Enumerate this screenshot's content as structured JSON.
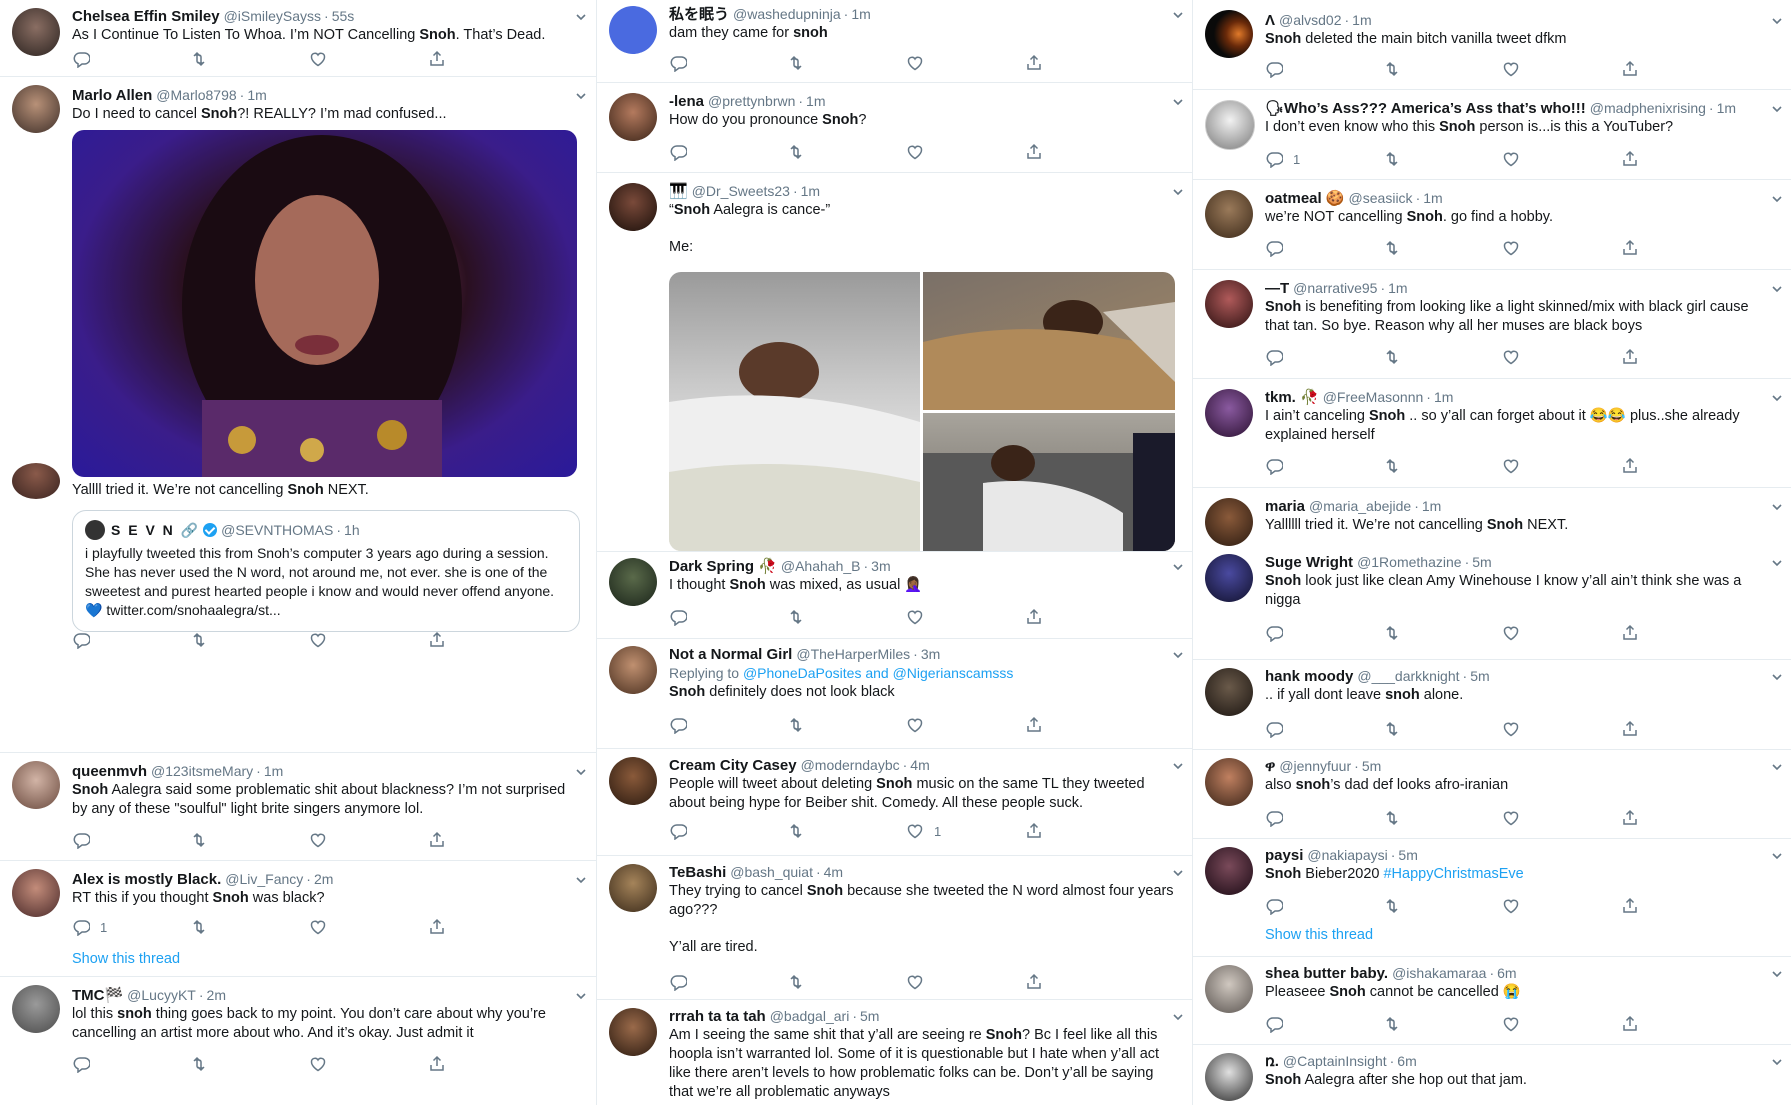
{
  "colors": {
    "accent": "#1da1f2",
    "muted": "#657786",
    "text": "#14171a",
    "divider": "#e6ecf0"
  },
  "icons": {
    "reply": "reply-icon",
    "retweet": "retweet-icon",
    "like": "heart-icon",
    "share": "share-icon",
    "caret": "chevron-down-icon"
  },
  "col1": {
    "t1": {
      "name": "Chelsea Effin Smiley",
      "handle": "@iSmileySayss",
      "time": "55s",
      "text_pre": "As I Continue To Listen To Whoa. I’m NOT Cancelling ",
      "text_bold": "Snoh",
      "text_post": ". That’s Dead."
    },
    "t2": {
      "name": "Marlo Allen",
      "handle": "@Marlo8798",
      "time": "1m",
      "text_pre": "Do I need to cancel ",
      "text_bold": "Snoh",
      "text_post": "?! REALLY? I’m mad confused..."
    },
    "t3": {
      "text_pre": "Yallll tried it. We’re not cancelling ",
      "text_bold": "Snoh",
      "text_post": " NEXT.",
      "quote": {
        "name": "S E V N 🔗",
        "handle": "@SEVNTHOMAS",
        "time": "1h",
        "text": "i playfully tweeted this from Snoh’s computer 3 years ago during a session. She has never used the N word, not around me, not ever. she is one of the sweetest and purest hearted people i know and would never offend anyone. 💙 twitter.com/snohaalegra/st..."
      }
    },
    "t4": {
      "name": "queenmvh",
      "handle": "@123itsmeMary",
      "time": "1m",
      "text_bold": "Snoh",
      "text_post": " Aalegra said some problematic shit about blackness? I’m not surprised by any of these \"soulful\" light brite singers anymore lol."
    },
    "t5": {
      "name": "Alex is mostly Black.",
      "handle": "@Liv_Fancy",
      "time": "2m",
      "text_pre": "RT this if you thought ",
      "text_bold": "Snoh",
      "text_post": " was black?",
      "reply_count": "1",
      "show_thread": "Show this thread"
    },
    "t6": {
      "name": "TMC🏁",
      "handle": "@LucyyKT",
      "time": "2m",
      "text_pre": "lol this ",
      "text_bold": "snoh",
      "text_post": " thing goes back to my point. You don’t care about why you’re cancelling an artist more about who. And it’s okay. Just admit it"
    }
  },
  "col2": {
    "t1": {
      "name": "私を眠う",
      "handle": "@washedupninja",
      "time": "1m",
      "text_pre": "dam they came for ",
      "text_bold": "snoh",
      "text_post": ""
    },
    "t2": {
      "name": "-lena",
      "handle": "@prettynbrwn",
      "time": "1m",
      "text_pre": "How do you pronounce ",
      "text_bold": "Snoh",
      "text_post": "?"
    },
    "t3": {
      "name": "🎹",
      "handle": "@Dr_Sweets23",
      "time": "1m",
      "text_pre": "“",
      "text_bold": "Snoh",
      "text_post": " Aalegra is cance-”",
      "line2": "Me:"
    },
    "t4": {
      "name": "Dark Spring 🥀",
      "handle": "@Ahahah_B",
      "time": "3m",
      "text_pre": "I thought ",
      "text_bold": "Snoh",
      "text_post": " was mixed, as usual 🤦🏾‍♀️"
    },
    "t5": {
      "name": "Not a Normal Girl",
      "handle": "@TheHarperMiles",
      "time": "3m",
      "reply_label": "Replying to ",
      "reply_targets": "@PhoneDaPosites and @Nigerianscamsss",
      "text_bold": "Snoh",
      "text_post": " definitely does not look black"
    },
    "t6": {
      "name": "Cream City Casey",
      "handle": "@moderndaybc",
      "time": "4m",
      "text_pre": "People will tweet about deleting ",
      "text_bold": "Snoh",
      "text_post": " music on the same TL they tweeted about being hype for Beiber shit. Comedy. All these people suck.",
      "like_count": "1"
    },
    "t7": {
      "name": "TeBashi",
      "handle": "@bash_quiat",
      "time": "4m",
      "text_pre": "They trying to cancel ",
      "text_bold": "Snoh",
      "text_post": " because she tweeted the N word almost four years ago???",
      "line2": "Y’all are tired."
    },
    "t8": {
      "name": "rrrah ta ta tah",
      "handle": "@badgal_ari",
      "time": "5m",
      "text_pre": "Am I seeing the same shit that y’all are seeing re ",
      "text_bold": "Snoh",
      "text_post": "? Bc I feel like all this hoopla isn’t warranted lol. Some of it is questionable but I hate when y’all act like there aren’t levels to how problematic folks can be. Don’t y’all be saying that we’re all problematic anyways"
    }
  },
  "col3": {
    "t1": {
      "name": "Λ",
      "handle": "@alvsd02",
      "time": "1m",
      "text_bold": "Snoh",
      "text_post": " deleted the main bitch vanilla tweet dfkm"
    },
    "t2": {
      "name": "🗣Who’s Ass??? America’s Ass that’s who!!!",
      "handle": "@madphenixrising",
      "time": "1m",
      "text_pre": "I don’t even know who this ",
      "text_bold": "Snoh",
      "text_post": " person is...is this a YouTuber?",
      "reply_count": "1"
    },
    "t3": {
      "name": "oatmeal 🍪",
      "handle": "@seasiick",
      "time": "1m",
      "text_pre": "we’re NOT cancelling ",
      "text_bold": "Snoh",
      "text_post": ". go find a hobby."
    },
    "t4": {
      "name": "—T",
      "handle": "@narrative95",
      "time": "1m",
      "text_bold": "Snoh",
      "text_post": " is benefiting from looking like a light skinned/mix with black girl cause that tan. So bye. Reason why all her muses are black boys"
    },
    "t5": {
      "name": "tkm. 🥀",
      "handle": "@FreeMasonnn",
      "time": "1m",
      "text_pre": "I ain’t canceling ",
      "text_bold": "Snoh",
      "text_post": " .. so y’all can forget about it 😂😂 plus..she already explained herself"
    },
    "t6": {
      "name": "maria",
      "handle": "@maria_abejide",
      "time": "1m",
      "text_pre": "Yallllll tried it. We’re not cancelling ",
      "text_bold": "Snoh",
      "text_post": " NEXT."
    },
    "t7": {
      "name": "Suge Wright",
      "handle": "@1Romethazine",
      "time": "5m",
      "text_bold": "Snoh",
      "text_post": " look just like clean Amy Winehouse I know y’all ain’t think she was a nigga"
    },
    "t8": {
      "name": "hank moody",
      "handle": "@___darkknight",
      "time": "5m",
      "text_pre": ".. if yall dont leave ",
      "text_bold": "snoh",
      "text_post": " alone."
    },
    "t9": {
      "name": "ዋ",
      "handle": "@jennyfuur",
      "time": "5m",
      "text_pre": "also ",
      "text_bold": "snoh",
      "text_post": "’s dad def looks afro-iranian"
    },
    "t10": {
      "name": "paysi",
      "handle": "@nakiapaysi",
      "time": "5m",
      "text_bold": "Snoh",
      "text_post": " Bieber2020 ",
      "hashtag": "#HappyChristmasEve",
      "show_thread": "Show this thread"
    },
    "t11": {
      "name": "shea butter baby.",
      "handle": "@ishakamaraa",
      "time": "6m",
      "text_pre": "Pleaseee ",
      "text_bold": "Snoh",
      "text_post": " cannot be cancelled 😭"
    },
    "t12": {
      "name": "ռ.",
      "handle": "@CaptainInsight",
      "time": "6m",
      "text_bold": "Snoh",
      "text_post": " Aalegra after she hop out that jam."
    }
  }
}
